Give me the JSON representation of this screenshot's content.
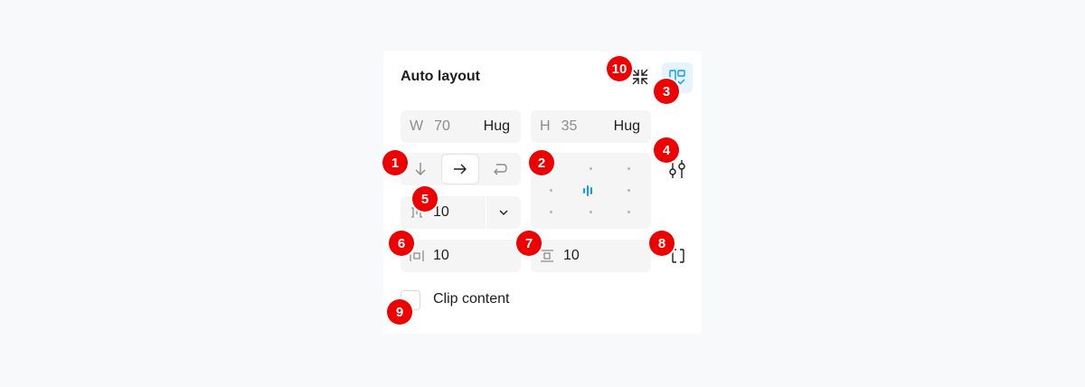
{
  "panel": {
    "title": "Auto layout",
    "width": {
      "prefix": "W",
      "value": "70",
      "mode": "Hug"
    },
    "height": {
      "prefix": "H",
      "value": "35",
      "mode": "Hug"
    },
    "gap": "10",
    "horizontal_padding": "10",
    "vertical_padding": "10",
    "clip_label": "Clip content",
    "direction_selected": "horizontal"
  },
  "icons": {
    "collapse": "collapse-arrows-icon",
    "suggest": "suggest-layout-icon",
    "down": "arrow-down-icon",
    "right": "arrow-right-icon",
    "wrap": "wrap-icon",
    "settings": "sliders-icon",
    "gap": "gap-icon",
    "chevron": "chevron-down-icon",
    "hpad": "horizontal-padding-icon",
    "vpad": "vertical-padding-icon",
    "pad": "individual-padding-icon"
  },
  "colors": {
    "accent": "#0d99ff",
    "badge": "#ee0000",
    "field_bg": "#f5f5f5",
    "suggest_bg": "#e5f4ff"
  },
  "badges": [
    "1",
    "2",
    "3",
    "4",
    "5",
    "6",
    "7",
    "8",
    "9",
    "10"
  ]
}
